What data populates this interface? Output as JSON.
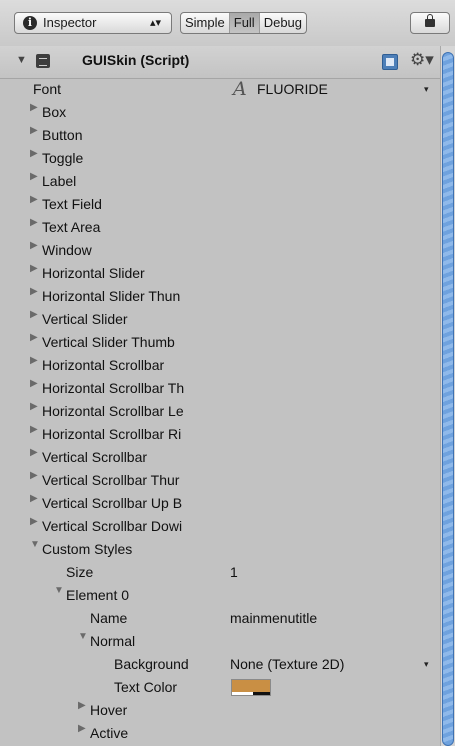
{
  "toolbar": {
    "inspector_label": "Inspector",
    "modes": [
      "Simple",
      "Full",
      "Debug"
    ],
    "active_mode": "Full"
  },
  "component": {
    "title": "GUISkin (Script)"
  },
  "properties": {
    "font_label": "Font",
    "font_value": "FLUORIDE",
    "font_glyph": "A",
    "items": [
      "Box",
      "Button",
      "Toggle",
      "Label",
      "Text Field",
      "Text Area",
      "Window",
      "Horizontal Slider",
      "Horizontal Slider Thun",
      "Vertical Slider",
      "Vertical Slider Thumb",
      "Horizontal Scrollbar",
      "Horizontal Scrollbar Th",
      "Horizontal Scrollbar Le",
      "Horizontal Scrollbar Ri",
      "Vertical Scrollbar",
      "Vertical Scrollbar Thur",
      "Vertical Scrollbar Up B",
      "Vertical Scrollbar Dowi"
    ],
    "custom_styles": {
      "label": "Custom Styles",
      "size_label": "Size",
      "size_value": "1",
      "element_label": "Element 0",
      "name_label": "Name",
      "name_value": "mainmenutitle",
      "normal_label": "Normal",
      "background_label": "Background",
      "background_value": "None (Texture 2D)",
      "text_color_label": "Text Color",
      "text_color_value": "#c98f44",
      "hover_label": "Hover",
      "active_label": "Active"
    }
  }
}
